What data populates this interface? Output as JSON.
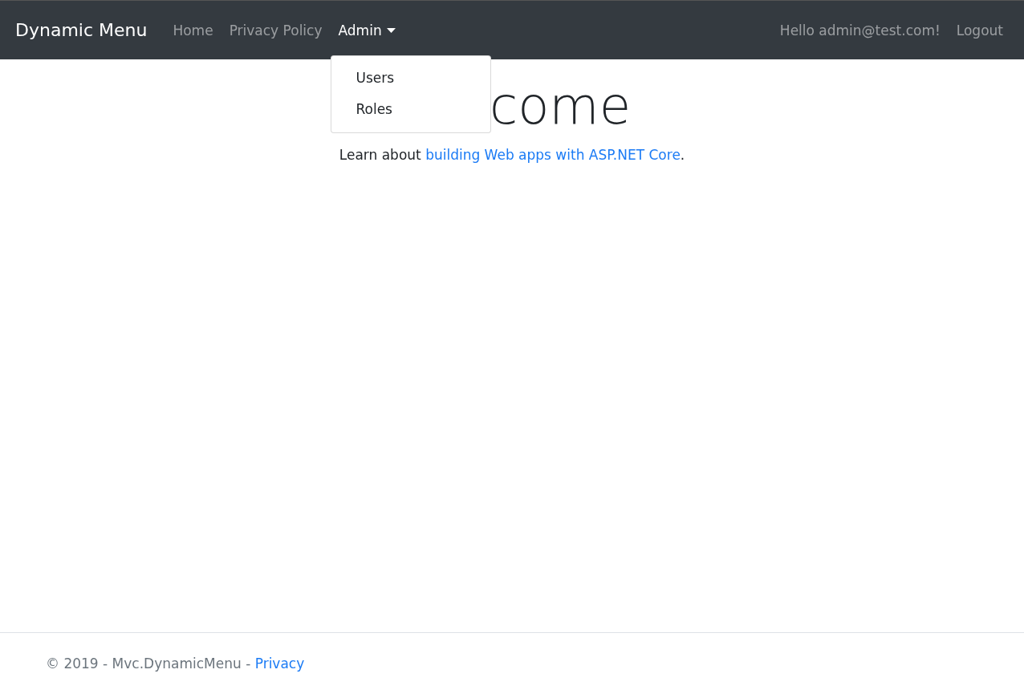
{
  "navbar": {
    "brand": "Dynamic Menu",
    "links": [
      {
        "label": "Home",
        "selected": false
      },
      {
        "label": "Privacy Policy",
        "selected": false
      },
      {
        "label": "Admin",
        "selected": true,
        "menu": [
          "Users",
          "Roles"
        ]
      }
    ],
    "greeting": "Hello admin@test.com!",
    "logout": "Logout"
  },
  "main": {
    "heading": "come",
    "lead_before": "Learn about ",
    "lead_link": "building Web apps with ASP.NET Core",
    "lead_after": "."
  },
  "footer": {
    "text": "© 2019 - Mvc.DynamicMenu - ",
    "link": "Privacy"
  }
}
